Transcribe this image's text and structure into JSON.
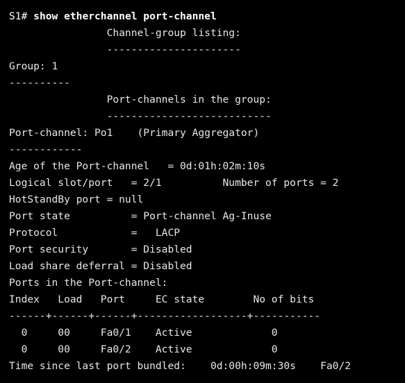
{
  "terminal": {
    "prompt": "S1# ",
    "command": "show etherchannel port-channel",
    "lines": [
      "                Channel-group listing:",
      "                ----------------------",
      "Group: 1",
      "----------",
      "                Port-channels in the group:",
      "                ---------------------------",
      "Port-channel: Po1    (Primary Aggregator)",
      "------------",
      "Age of the Port-channel   = 0d:01h:02m:10s",
      "Logical slot/port   = 2/1          Number of ports = 2",
      "HotStandBy port = null",
      "Port state          = Port-channel Ag-Inuse",
      "Protocol            =   LACP",
      "Port security       = Disabled",
      "Load share deferral = Disabled",
      "Ports in the Port-channel:",
      "Index   Load   Port     EC state        No of bits",
      "------+------+------+------------------+-----------",
      "  0     00     Fa0/1    Active             0",
      "  0     00     Fa0/2    Active             0",
      "Time since last port bundled:    0d:00h:09m:30s    Fa0/2"
    ]
  },
  "colors": {
    "background": "#000000",
    "text": "#e8e8e8"
  }
}
